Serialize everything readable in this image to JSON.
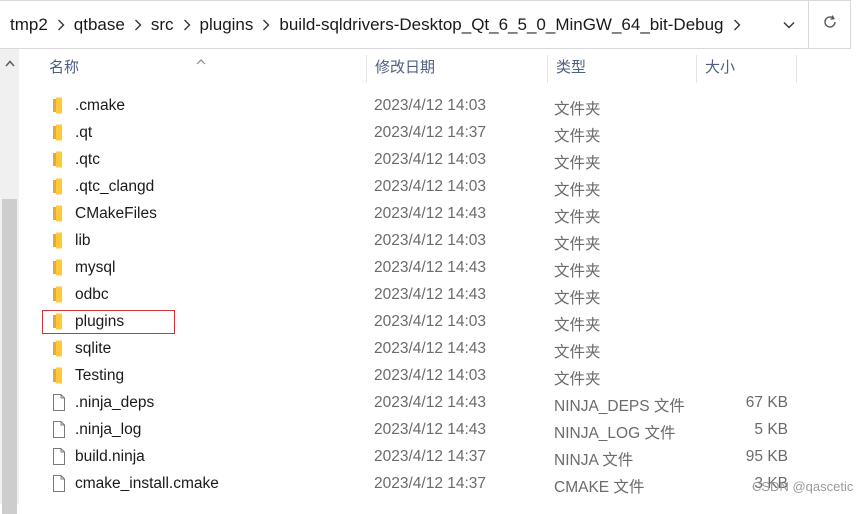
{
  "breadcrumb": [
    "tmp2",
    "qtbase",
    "src",
    "plugins",
    "build-sqldrivers-Desktop_Qt_6_5_0_MinGW_64_bit-Debug"
  ],
  "columns": {
    "name": "名称",
    "date": "修改日期",
    "type": "类型",
    "size": "大小"
  },
  "files": [
    {
      "name": ".cmake",
      "date": "2023/4/12 14:03",
      "type": "文件夹",
      "size": "",
      "kind": "folder"
    },
    {
      "name": ".qt",
      "date": "2023/4/12 14:37",
      "type": "文件夹",
      "size": "",
      "kind": "folder"
    },
    {
      "name": ".qtc",
      "date": "2023/4/12 14:03",
      "type": "文件夹",
      "size": "",
      "kind": "folder"
    },
    {
      "name": ".qtc_clangd",
      "date": "2023/4/12 14:03",
      "type": "文件夹",
      "size": "",
      "kind": "folder"
    },
    {
      "name": "CMakeFiles",
      "date": "2023/4/12 14:43",
      "type": "文件夹",
      "size": "",
      "kind": "folder"
    },
    {
      "name": "lib",
      "date": "2023/4/12 14:03",
      "type": "文件夹",
      "size": "",
      "kind": "folder"
    },
    {
      "name": "mysql",
      "date": "2023/4/12 14:43",
      "type": "文件夹",
      "size": "",
      "kind": "folder"
    },
    {
      "name": "odbc",
      "date": "2023/4/12 14:43",
      "type": "文件夹",
      "size": "",
      "kind": "folder"
    },
    {
      "name": "plugins",
      "date": "2023/4/12 14:03",
      "type": "文件夹",
      "size": "",
      "kind": "folder"
    },
    {
      "name": "sqlite",
      "date": "2023/4/12 14:43",
      "type": "文件夹",
      "size": "",
      "kind": "folder"
    },
    {
      "name": "Testing",
      "date": "2023/4/12 14:03",
      "type": "文件夹",
      "size": "",
      "kind": "folder"
    },
    {
      "name": ".ninja_deps",
      "date": "2023/4/12 14:43",
      "type": "NINJA_DEPS 文件",
      "size": "67 KB",
      "kind": "file"
    },
    {
      "name": ".ninja_log",
      "date": "2023/4/12 14:43",
      "type": "NINJA_LOG 文件",
      "size": "5 KB",
      "kind": "file"
    },
    {
      "name": "build.ninja",
      "date": "2023/4/12 14:37",
      "type": "NINJA 文件",
      "size": "95 KB",
      "kind": "file"
    },
    {
      "name": "cmake_install.cmake",
      "date": "2023/4/12 14:37",
      "type": "CMAKE 文件",
      "size": "3 KB",
      "kind": "file"
    }
  ],
  "watermark": "CSDN @qascetic",
  "colors": {
    "folder": "#ffc83d",
    "highlight": "#d0343b",
    "header_text": "#4d6082"
  }
}
